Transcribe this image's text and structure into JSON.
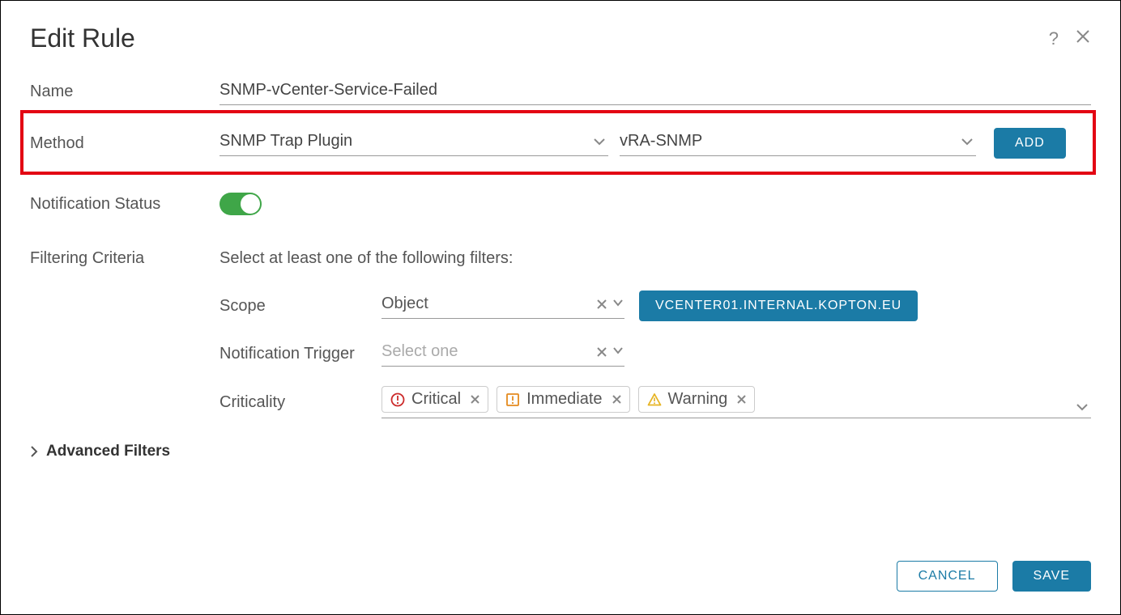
{
  "dialog": {
    "title": "Edit Rule"
  },
  "labels": {
    "name": "Name",
    "method": "Method",
    "notification_status": "Notification Status",
    "filtering_criteria": "Filtering Criteria"
  },
  "fields": {
    "name_value": "SNMP-vCenter-Service-Failed",
    "method_plugin": "SNMP Trap Plugin",
    "method_instance": "vRA-SNMP"
  },
  "buttons": {
    "add": "ADD",
    "cancel": "CANCEL",
    "save": "SAVE"
  },
  "filtering": {
    "instruction": "Select at least one of the following filters:",
    "scope_label": "Scope",
    "scope_value": "Object",
    "scope_tag": "VCENTER01.INTERNAL.KOPTON.EU",
    "trigger_label": "Notification Trigger",
    "trigger_placeholder": "Select one",
    "criticality_label": "Criticality",
    "criticality_chips": {
      "critical": "Critical",
      "immediate": "Immediate",
      "warning": "Warning"
    },
    "advanced_filters": "Advanced Filters"
  },
  "toggles": {
    "notification_status": true
  }
}
